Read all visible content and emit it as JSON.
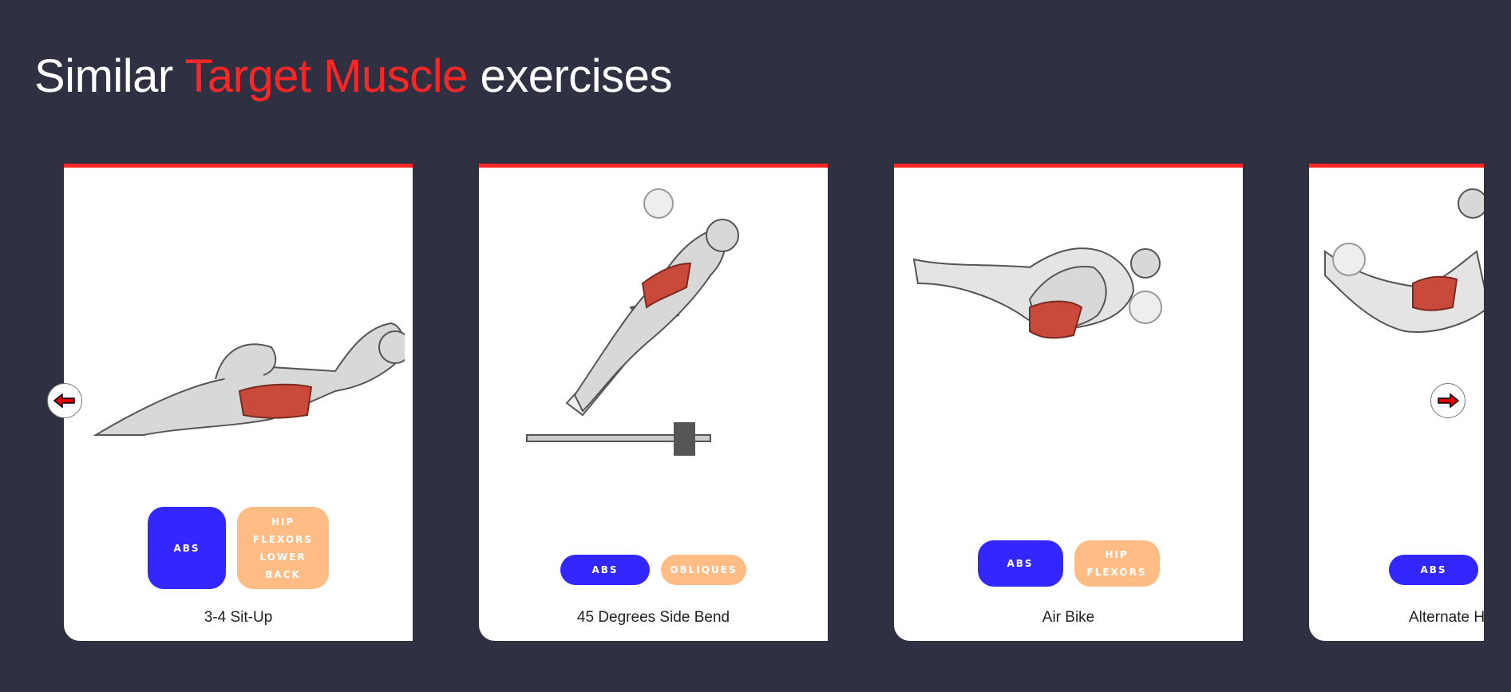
{
  "heading": {
    "prefix": "Similar",
    "highlight": "Target Muscle",
    "suffix": "exercises"
  },
  "cards": [
    {
      "name": "3-4 Sit-Up",
      "tags": [
        "ABS",
        "HIP FLEXORS LOWER BACK"
      ]
    },
    {
      "name": "45 Degrees Side Bend",
      "tags": [
        "ABS",
        "OBLIQUES"
      ]
    },
    {
      "name": "Air Bike",
      "tags": [
        "ABS",
        "HIP FLEXORS"
      ]
    },
    {
      "name": "Alternate He",
      "tags": [
        "ABS"
      ]
    }
  ],
  "colors": {
    "background": "#2f3042",
    "accent": "#ff2625",
    "tag_blue": "#3227ff",
    "tag_orange": "#ffbc84"
  },
  "icons": {
    "prev": "arrow-left-icon",
    "next": "arrow-right-icon"
  }
}
